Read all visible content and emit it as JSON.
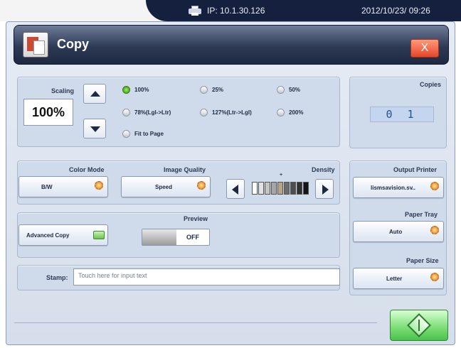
{
  "status_bar": {
    "ip": "IP: 10.1.30.126",
    "datetime": "2012/10/23/ 09:26",
    "printer_icon": "printer-icon"
  },
  "titlebar": {
    "title": "Copy",
    "close_label": "X",
    "app_icon": "copy-icon"
  },
  "scaling": {
    "label": "Scaling",
    "value": "100%",
    "options": [
      {
        "label": "100%",
        "selected": true
      },
      {
        "label": "25%",
        "selected": false
      },
      {
        "label": "50%",
        "selected": false
      },
      {
        "label": "78%(Lgl->Ltr)",
        "selected": false
      },
      {
        "label": "127%(Ltr->Lgl)",
        "selected": false
      },
      {
        "label": "200%",
        "selected": false
      },
      {
        "label": "Fit to Page",
        "selected": false
      }
    ]
  },
  "copies": {
    "label": "Copies",
    "value": "0 1"
  },
  "color_mode": {
    "label": "Color Mode",
    "value": "B/W"
  },
  "image_quality": {
    "label": "Image Quality",
    "value": "Speed"
  },
  "density": {
    "label": "Density",
    "marker": "+",
    "level": 5,
    "levels": 9
  },
  "output_printer": {
    "label": "Output Printer",
    "value": "lismsavision.sv.."
  },
  "advanced": {
    "label": "Advanced Copy"
  },
  "preview": {
    "label": "Preview",
    "state": "OFF"
  },
  "paper_tray": {
    "label": "Paper Tray",
    "value": "Auto"
  },
  "paper_size": {
    "label": "Paper Size",
    "value": "Letter"
  },
  "stamp": {
    "label": "Stamp:",
    "placeholder": "Touch here for input text"
  },
  "colors": {
    "titlebar": "#2d3a55",
    "close": "#e6462a",
    "start": "#49c24a",
    "radio_selected": "#54b82a",
    "panel": "#cfdbea"
  }
}
